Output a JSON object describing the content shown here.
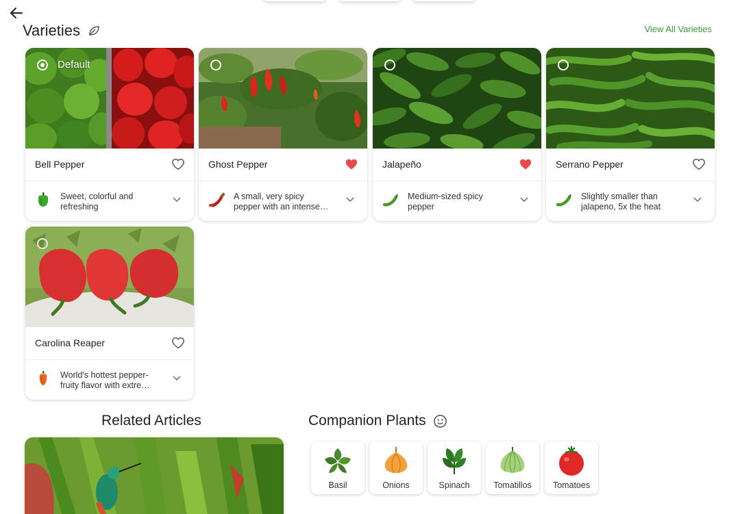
{
  "header": {
    "title": "Varieties",
    "view_all_label": "View All Varieties"
  },
  "varieties": [
    {
      "name": "Bell Pepper",
      "description": "Sweet, colorful and refreshing",
      "selected": true,
      "badge": "Default",
      "favorite": false,
      "icon": "bell-pepper-icon"
    },
    {
      "name": "Ghost Pepper",
      "description": "A small, very spicy pepper with an intense, fruity heat",
      "selected": false,
      "favorite": true,
      "icon": "chili-pepper-icon"
    },
    {
      "name": "Jalapeño",
      "description": "Medium-sized spicy pepper",
      "selected": false,
      "favorite": true,
      "icon": "green-chili-icon"
    },
    {
      "name": "Serrano Pepper",
      "description": "Slightly smaller than jalapeno, 5x the heat",
      "selected": false,
      "favorite": false,
      "icon": "green-chili-icon"
    },
    {
      "name": "Carolina Reaper",
      "description": "World's hottest pepper- fruity flavor with extreme heat",
      "selected": false,
      "favorite": false,
      "icon": "orange-pepper-icon"
    }
  ],
  "articles": {
    "title": "Related Articles"
  },
  "companions": {
    "title": "Companion Plants",
    "items": [
      {
        "label": "Basil",
        "icon": "basil-icon"
      },
      {
        "label": "Onions",
        "icon": "onion-icon"
      },
      {
        "label": "Spinach",
        "icon": "spinach-icon"
      },
      {
        "label": "Tomatillos",
        "icon": "tomatillo-icon"
      },
      {
        "label": "Tomatoes",
        "icon": "tomato-icon"
      }
    ]
  },
  "colors": {
    "accent": "#3a9a3a",
    "heart_active": "#e84a4a",
    "heart_inactive": "#666666"
  }
}
